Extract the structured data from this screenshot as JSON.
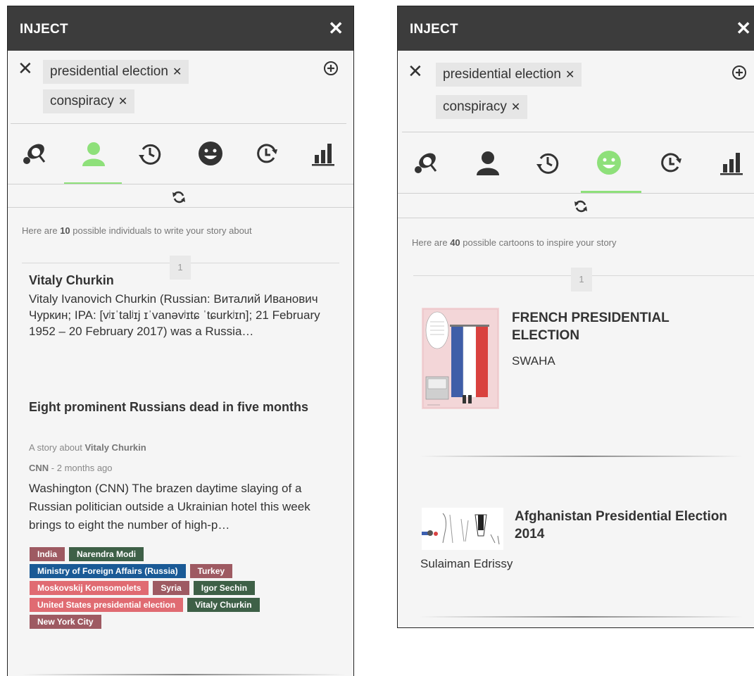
{
  "left": {
    "app_title": "INJECT",
    "close_glyph": "✕",
    "clear_glyph": "✕",
    "tags": [
      {
        "label": "presidential election",
        "remove": "✕"
      },
      {
        "label": "conspiracy",
        "remove": "✕"
      }
    ],
    "intro": {
      "prefix": "Here are ",
      "count": "10",
      "suffix": " possible individuals to write your story about"
    },
    "page_number": "1",
    "person": {
      "name": "Vitaly Churkin",
      "description": "Vitaly Ivanovich Churkin (Russian: Виталий Иванович Чуркин; IPA: [vʲɪˈtalʲɪj ɪˈvanəvʲɪtɕ ˈtɕurkʲɪn]; 21 February 1952 – 20 February 2017) was a Russia…"
    },
    "story": {
      "title": "Eight prominent Russians dead in five months",
      "about_prefix": "A story about ",
      "about_name": "Vitaly Churkin",
      "source": "CNN",
      "separator": " - ",
      "age": "2 months ago",
      "snippet": "Washington (CNN) The brazen daytime slaying of a Russian politician outside a Ukrainian hotel this week brings to eight the number of high-p…"
    },
    "chips": [
      [
        {
          "label": "India",
          "color": "#9e5a62"
        },
        {
          "label": "Narendra Modi",
          "color": "#3e6047"
        }
      ],
      [
        {
          "label": "Ministry of Foreign Affairs (Russia)",
          "color": "#1a5a96"
        },
        {
          "label": "Turkey",
          "color": "#9e5a62"
        }
      ],
      [
        {
          "label": "Moskovskij Komsomolets",
          "color": "#e06b72"
        },
        {
          "label": "Syria",
          "color": "#9e5a62"
        },
        {
          "label": "Igor Sechin",
          "color": "#3e6047"
        }
      ],
      [
        {
          "label": "United States presidential election",
          "color": "#e06b72"
        },
        {
          "label": "Vitaly Churkin",
          "color": "#3e6047"
        }
      ],
      [
        {
          "label": "New York City",
          "color": "#9e5a62"
        }
      ]
    ],
    "active_tab": "individuals"
  },
  "right": {
    "app_title": "INJECT",
    "close_glyph": "✕",
    "clear_glyph": "✕",
    "tags": [
      {
        "label": "presidential election",
        "remove": "✕"
      },
      {
        "label": "conspiracy",
        "remove": "✕"
      }
    ],
    "intro": {
      "prefix": "Here are ",
      "count": "40",
      "suffix": " possible cartoons to inspire your story"
    },
    "page_number": "1",
    "cartoons": [
      {
        "title": "FRENCH PRESIDENTIAL ELECTION",
        "author": "SWAHA"
      },
      {
        "title": "Afghanistan Presidential Election 2014",
        "author": "Sulaiman Edrissy"
      }
    ],
    "active_tab": "cartoons"
  },
  "icons": [
    "explore-icon",
    "person-icon",
    "history-icon",
    "smiley-icon",
    "clock-icon",
    "bar-chart-icon",
    "refresh-icon",
    "add-circle-icon"
  ],
  "colors": {
    "accent": "#8ee07a",
    "header": "#3c3c3c",
    "panel_bg": "#f5f5f5"
  }
}
